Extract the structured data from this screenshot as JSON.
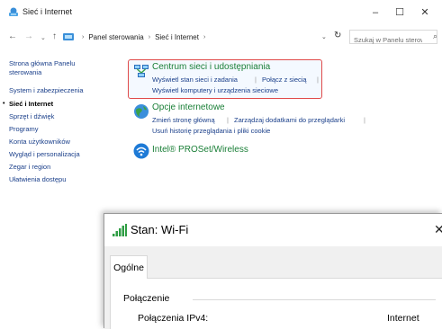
{
  "window": {
    "title": "Sieć i Internet",
    "minimize": "–",
    "maximize": "☐",
    "close": "✕"
  },
  "addressbar": {
    "back": "←",
    "forward": "→",
    "recent": "⌄",
    "up": "↑",
    "crumbs": [
      "Panel sterowania",
      "Sieć i Internet"
    ],
    "crumb_sep": "›",
    "dropdown": "⌄",
    "refresh": "↻",
    "search_placeholder": "Szukaj w Panelu sterowania",
    "search_icon": "⌕"
  },
  "leftnav": {
    "items": [
      "Strona główna Panelu sterowania",
      "System i zabezpieczenia",
      "Sieć i Internet",
      "Sprzęt i dźwięk",
      "Programy",
      "Konta użytkowników",
      "Wygląd i personalizacja",
      "Zegar i region",
      "Ułatwienia dostępu"
    ],
    "current_bullet": "•"
  },
  "categories": {
    "network_center": {
      "title": "Centrum sieci i udostępniania",
      "links": [
        "Wyświetl stan sieci i zadania",
        "Połącz z siecią",
        "Wyświetl komputery i urządzenia sieciowe"
      ]
    },
    "internet_options": {
      "title": "Opcje internetowe",
      "links": [
        "Zmień stronę główną",
        "Zarządzaj dodatkami do przeglądarki",
        "Usuń historię przeglądania i pliki cookie"
      ]
    },
    "proset": {
      "title": "Intel® PROSet/Wireless"
    },
    "link_sep": "|"
  },
  "wifi_dialog": {
    "title": "Stan: Wi-Fi",
    "close": "✕",
    "tab": "Ogólne",
    "group": "Połączenie",
    "row_label": "Połączenia IPv4:",
    "row_value": "Internet"
  },
  "colors": {
    "category_title": "#1a7f37",
    "link": "#1a3f8a",
    "highlight_border": "#e04a4a"
  }
}
